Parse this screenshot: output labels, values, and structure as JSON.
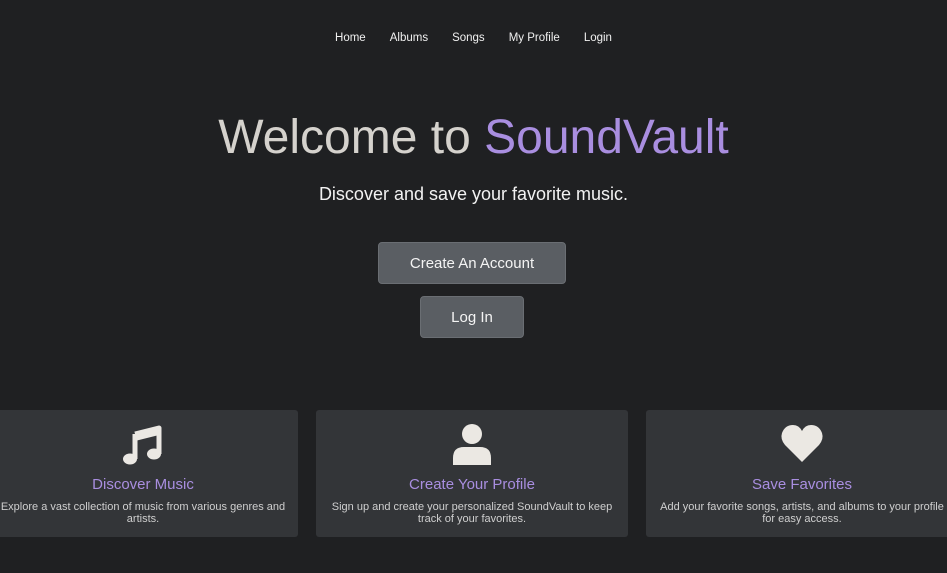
{
  "nav": {
    "items": [
      {
        "label": "Home"
      },
      {
        "label": "Albums"
      },
      {
        "label": "Songs"
      },
      {
        "label": "My Profile"
      },
      {
        "label": "Login"
      }
    ]
  },
  "hero": {
    "title_prefix": "Welcome to ",
    "title_brand": "SoundVault",
    "subtitle": "Discover and save your favorite music.",
    "create_account_label": "Create An Account",
    "login_label": "Log In"
  },
  "features": [
    {
      "icon": "music-note-icon",
      "title": "Discover Music",
      "description": "Explore a vast collection of music from various genres and artists."
    },
    {
      "icon": "user-icon",
      "title": "Create Your Profile",
      "description": "Sign up and create your personalized SoundVault to keep track of your favorites."
    },
    {
      "icon": "heart-icon",
      "title": "Save Favorites",
      "description": "Add your favorite songs, artists, and albums to your profile for easy access."
    }
  ],
  "colors": {
    "background": "#1f2022",
    "accent": "#a98ee0",
    "button": "#5a5e63",
    "card": "#333538"
  }
}
